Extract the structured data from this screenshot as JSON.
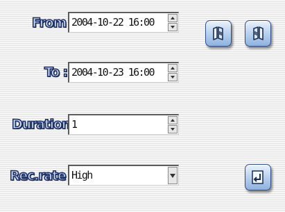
{
  "labels": {
    "from": "From :",
    "to": "To :",
    "duration": "Duration :",
    "rec_rate": "Rec.rate :"
  },
  "fields": {
    "from_value": "2004-10-22 16:00",
    "to_value": "2004-10-23 16:00",
    "duration_value": "1",
    "rec_rate_selected": "High"
  },
  "icons": {
    "button_1": "jump-start-icon",
    "button_2": "jump-end-icon",
    "button_3": "enter-icon"
  },
  "colors": {
    "label_fill": "#cfdcf4",
    "label_outline": "#1d3064",
    "button_blue": "#8fb2e0"
  }
}
